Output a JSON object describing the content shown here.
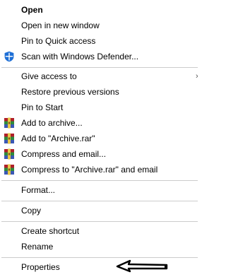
{
  "context_menu": {
    "items": [
      {
        "label": "Open"
      },
      {
        "label": "Open in new window"
      },
      {
        "label": "Pin to Quick access"
      },
      {
        "label": "Scan with Windows Defender...",
        "icon": "windows-defender-shield-icon"
      },
      {
        "label": "Give access to",
        "submenu_indicator": "›"
      },
      {
        "label": "Restore previous versions"
      },
      {
        "label": "Pin to Start"
      },
      {
        "label": "Add to archive...",
        "icon": "winrar-icon"
      },
      {
        "label": "Add to \"Archive.rar\"",
        "icon": "winrar-icon"
      },
      {
        "label": "Compress and email...",
        "icon": "winrar-icon"
      },
      {
        "label": "Compress to \"Archive.rar\" and email",
        "icon": "winrar-icon"
      },
      {
        "label": "Format..."
      },
      {
        "label": "Copy"
      },
      {
        "label": "Create shortcut"
      },
      {
        "label": "Rename"
      },
      {
        "label": "Properties"
      }
    ]
  },
  "annotation": {
    "icon": "hand-drawn-arrow-pointing-left",
    "color": "#000000"
  },
  "colors": {
    "background": "#ffffff",
    "separator": "#cccccc",
    "defender_blue": "#1e6fd6",
    "winrar_red": "#b0202a",
    "winrar_green": "#2e8b3d",
    "winrar_blue": "#3a58b5"
  }
}
